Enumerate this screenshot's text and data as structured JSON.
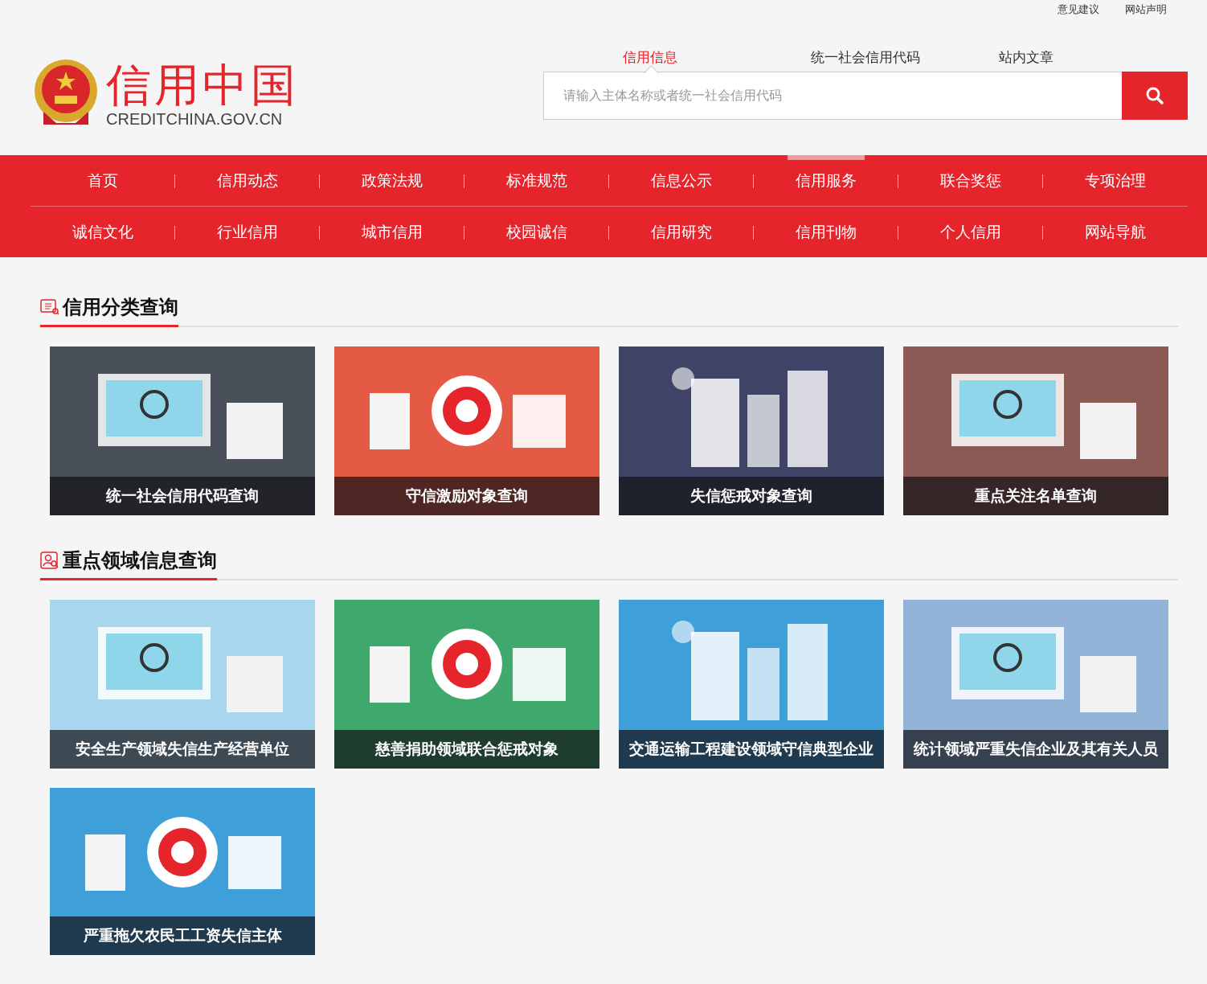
{
  "top_links": [
    "意见建议",
    "网站声明"
  ],
  "logo": {
    "title": "信用中国",
    "subtitle": "CREDITCHINA.GOV.CN"
  },
  "search": {
    "tabs": [
      {
        "label": "信用信息",
        "selected": true
      },
      {
        "label": "统一社会信用代码",
        "selected": false
      },
      {
        "label": "站内文章",
        "selected": false
      }
    ],
    "placeholder": "请输入主体名称或者统一社会信用代码"
  },
  "nav": {
    "rows": [
      [
        {
          "label": "首页",
          "selected": false
        },
        {
          "label": "信用动态",
          "selected": false
        },
        {
          "label": "政策法规",
          "selected": false
        },
        {
          "label": "标准规范",
          "selected": false
        },
        {
          "label": "信息公示",
          "selected": false
        },
        {
          "label": "信用服务",
          "selected": true
        },
        {
          "label": "联合奖惩",
          "selected": false
        },
        {
          "label": "专项治理",
          "selected": false
        }
      ],
      [
        {
          "label": "诚信文化",
          "selected": false
        },
        {
          "label": "行业信用",
          "selected": false
        },
        {
          "label": "城市信用",
          "selected": false
        },
        {
          "label": "校园诚信",
          "selected": false
        },
        {
          "label": "信用研究",
          "selected": false
        },
        {
          "label": "信用刊物",
          "selected": false
        },
        {
          "label": "个人信用",
          "selected": false
        },
        {
          "label": "网站导航",
          "selected": false
        }
      ]
    ]
  },
  "sections": [
    {
      "title": "信用分类查询",
      "kind": "category",
      "cards": [
        {
          "caption": "统一社会信用代码查询",
          "color": "#4a505a"
        },
        {
          "caption": "守信激励对象查询",
          "color": "#e55a45"
        },
        {
          "caption": "失信惩戒对象查询",
          "color": "#3f4466"
        },
        {
          "caption": "重点关注名单查询",
          "color": "#8c5a54"
        }
      ]
    },
    {
      "title": "重点领域信息查询",
      "kind": "person",
      "cards": [
        {
          "caption": "安全生产领域失信生产经营单位",
          "color": "#a9d6ef"
        },
        {
          "caption": "慈善捐助领域联合惩戒对象",
          "color": "#3fa96d"
        },
        {
          "caption": "交通运输工程建设领域守信典型企业",
          "color": "#3e9fd9"
        },
        {
          "caption": "统计领域严重失信企业及其有关人员",
          "color": "#93b3d9"
        },
        {
          "caption": "严重拖欠农民工工资失信主体",
          "color": "#3e9fd9"
        }
      ]
    }
  ]
}
